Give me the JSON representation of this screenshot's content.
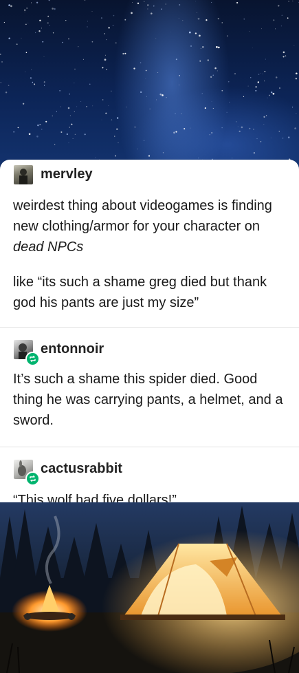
{
  "posts": [
    {
      "username": "mervley",
      "avatar_icon": "avatar-mervley",
      "reblog": false,
      "paragraph1_lead": "weirdest thing about videogames is finding new clothing/armor for your character on ",
      "paragraph1_italic": "dead NPCs",
      "paragraph2": "like “its such a shame greg died but thank god his pants are just my size”"
    },
    {
      "username": "entonnoir",
      "avatar_icon": "avatar-entonnoir",
      "reblog": true,
      "reblog_icon": "reblog-icon",
      "text": "It’s such a shame this spider died. Good thing he was carrying pants, a helmet, and a sword."
    },
    {
      "username": "cactusrabbit",
      "avatar_icon": "avatar-cactusrabbit",
      "reblog": true,
      "reblog_icon": "reblog-icon",
      "text": "“This wolf had five dollars!”"
    }
  ],
  "colors": {
    "reblog_green": "#00b46f",
    "card_background": "#ffffff",
    "text": "#1a1a1a"
  },
  "images": {
    "top": "starry-night-sky",
    "bottom": "glowing-tent-campfire-forest"
  }
}
